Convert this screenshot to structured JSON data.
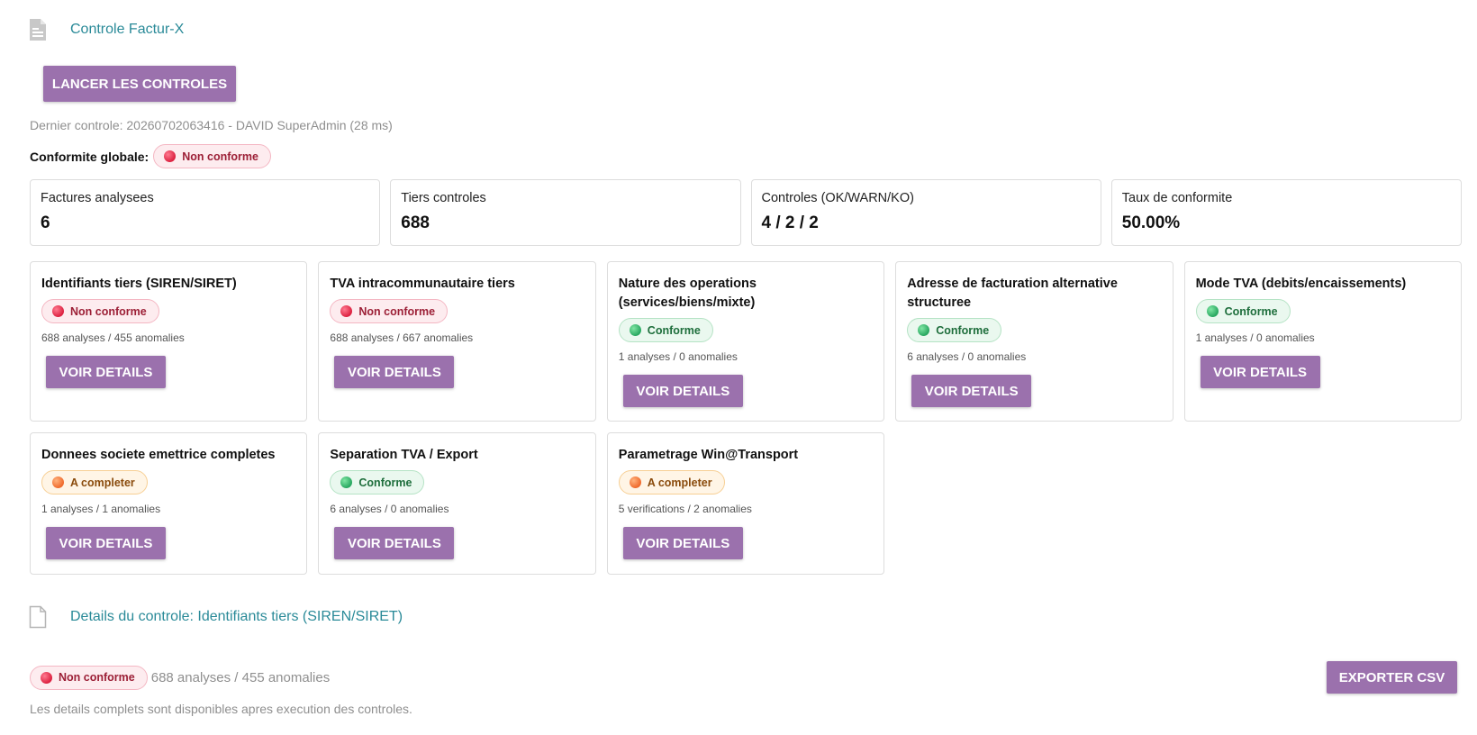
{
  "header": {
    "title": "Controle Factur-X",
    "run_button": "LANCER LES CONTROLES",
    "last_control": "Dernier controle: 20260702063416 - DAVID SuperAdmin (28 ms)",
    "global_label": "Conformite globale:",
    "global_status": "Non conforme"
  },
  "stats": [
    {
      "label": "Factures analysees",
      "value": "6"
    },
    {
      "label": "Tiers controles",
      "value": "688"
    },
    {
      "label": "Controles (OK/WARN/KO)",
      "value": "4 / 2 / 2"
    },
    {
      "label": "Taux de conformite",
      "value": "50.00%"
    }
  ],
  "cards": [
    {
      "title": "Identifiants tiers (SIREN/SIRET)",
      "status": "Non conforme",
      "stats": "688 analyses / 455 anomalies",
      "button": "VOIR DETAILS"
    },
    {
      "title": "TVA intracommunautaire tiers",
      "status": "Non conforme",
      "stats": "688 analyses / 667 anomalies",
      "button": "VOIR DETAILS"
    },
    {
      "title": "Nature des operations (services/biens/mixte)",
      "status": "Conforme",
      "stats": "1 analyses / 0 anomalies",
      "button": "VOIR DETAILS"
    },
    {
      "title": "Adresse de facturation alternative structuree",
      "status": "Conforme",
      "stats": "6 analyses / 0 anomalies",
      "button": "VOIR DETAILS"
    },
    {
      "title": "Mode TVA (debits/encaissements)",
      "status": "Conforme",
      "stats": "1 analyses / 0 anomalies",
      "button": "VOIR DETAILS"
    },
    {
      "title": "Donnees societe emettrice completes",
      "status": "A completer",
      "stats": "1 analyses / 1 anomalies",
      "button": "VOIR DETAILS"
    },
    {
      "title": "Separation TVA / Export",
      "status": "Conforme",
      "stats": "6 analyses / 0 anomalies",
      "button": "VOIR DETAILS"
    },
    {
      "title": "Parametrage Win@Transport",
      "status": "A completer",
      "stats": "5 verifications / 2 anomalies",
      "button": "VOIR DETAILS"
    }
  ],
  "detail": {
    "title": "Details du controle: Identifiants tiers (SIREN/SIRET)",
    "status": "Non conforme",
    "stats": "688 analyses / 455 anomalies",
    "export_button": "EXPORTER CSV",
    "note": "Les details complets sont disponibles apres execution des controles."
  },
  "icons": {
    "section": "document-icon",
    "detail": "document-outline-icon",
    "status_dot": "status-dot-icon"
  },
  "colors": {
    "accent": "#9b71ad",
    "link": "#2a8a98",
    "ko": "#dc2140",
    "ok": "#28a760",
    "warn": "#ef6a2c"
  }
}
